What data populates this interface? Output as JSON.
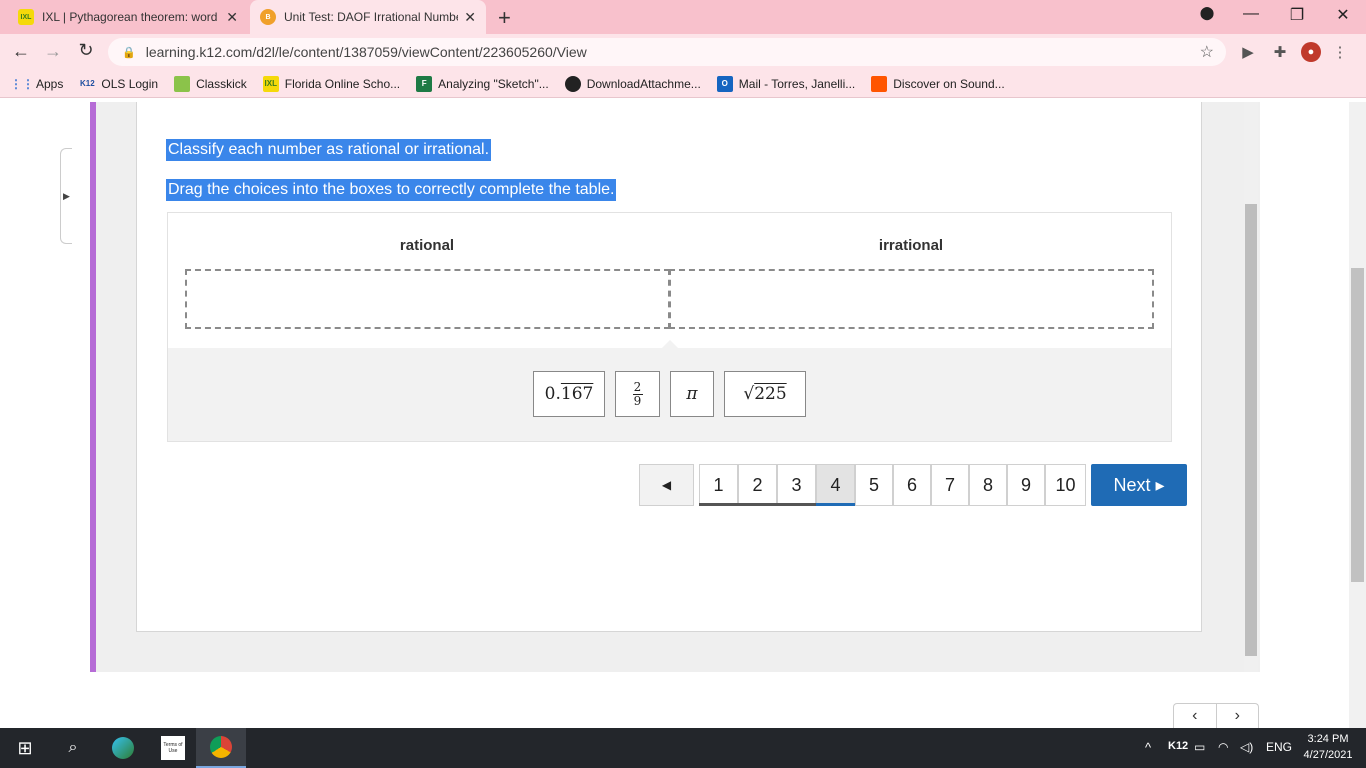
{
  "browser": {
    "tabs": [
      {
        "title": "IXL | Pythagorean theorem: word",
        "favicon": "IXL"
      },
      {
        "title": "Unit Test: DAOF Irrational Numbe",
        "favicon": "B"
      }
    ],
    "url": "learning.k12.com/d2l/le/content/1387059/viewContent/223605260/View",
    "bookmarks": [
      {
        "label": "Apps",
        "icon": "apps-grid-icon"
      },
      {
        "label": "OLS Login",
        "icon": "K12"
      },
      {
        "label": "Classkick",
        "icon": "classkick-icon"
      },
      {
        "label": "Florida Online Scho...",
        "icon": "IXL"
      },
      {
        "label": "Analyzing \"Sketch\"...",
        "icon": "forms-icon"
      },
      {
        "label": "DownloadAttachme...",
        "icon": "globe-icon"
      },
      {
        "label": "Mail - Torres, Janelli...",
        "icon": "outlook-icon"
      },
      {
        "label": "Discover on Sound...",
        "icon": "soundcloud-icon"
      }
    ]
  },
  "question": {
    "instruction1": "Classify each number as rational or irrational.",
    "instruction2": "Drag the choices into the boxes to correctly complete the table.",
    "columns": [
      "rational",
      "irrational"
    ],
    "choices": {
      "decimal_whole": "0.",
      "decimal_repeat": "167",
      "fraction_num": "2",
      "fraction_den": "9",
      "pi": "π",
      "sqrt_symbol": "√",
      "sqrt_value": "225"
    }
  },
  "pager": {
    "prev_label": "◀",
    "pages": [
      "1",
      "2",
      "3",
      "4",
      "5",
      "6",
      "7",
      "8",
      "9",
      "10"
    ],
    "current": "4",
    "next_label": "Next ▸"
  },
  "taskbar": {
    "lang": "ENG",
    "k12": "K12",
    "time": "3:24 PM",
    "date": "4/27/2021",
    "terms_icon_text": "Terms of Use"
  },
  "colors": {
    "accent_blue": "#1f6bb5",
    "highlight": "#3a86ea",
    "purple_bar": "#b66cd6",
    "tab_strip": "#f8c1cc"
  }
}
